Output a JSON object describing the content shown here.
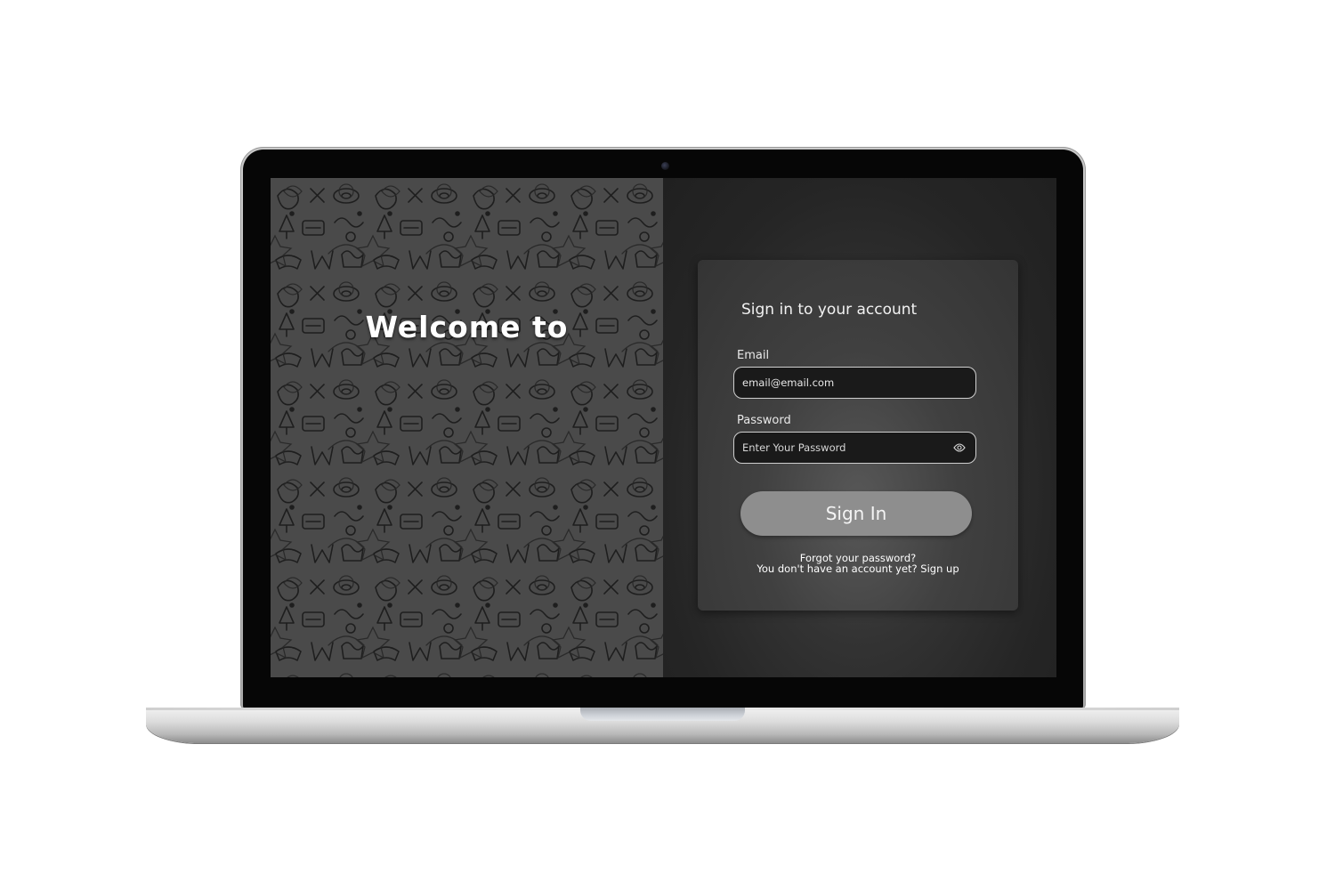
{
  "app": {
    "welcome_text": "Welcome to"
  },
  "login": {
    "title": "Sign in to your account",
    "email_label": "Email",
    "email_value": "email@email.com",
    "password_label": "Password",
    "password_placeholder": "Enter Your Password",
    "password_toggle_icon": "eye-icon",
    "sign_in_label": "Sign In",
    "forgot_password_text": "Forgot your password?",
    "signup_text": "You don't have an account yet? Sign up"
  },
  "colors": {
    "card_background": "#404040",
    "button_background": "#8e8e8e",
    "input_background": "#1a1a1a",
    "left_panel_background": "#4a4a4a"
  }
}
